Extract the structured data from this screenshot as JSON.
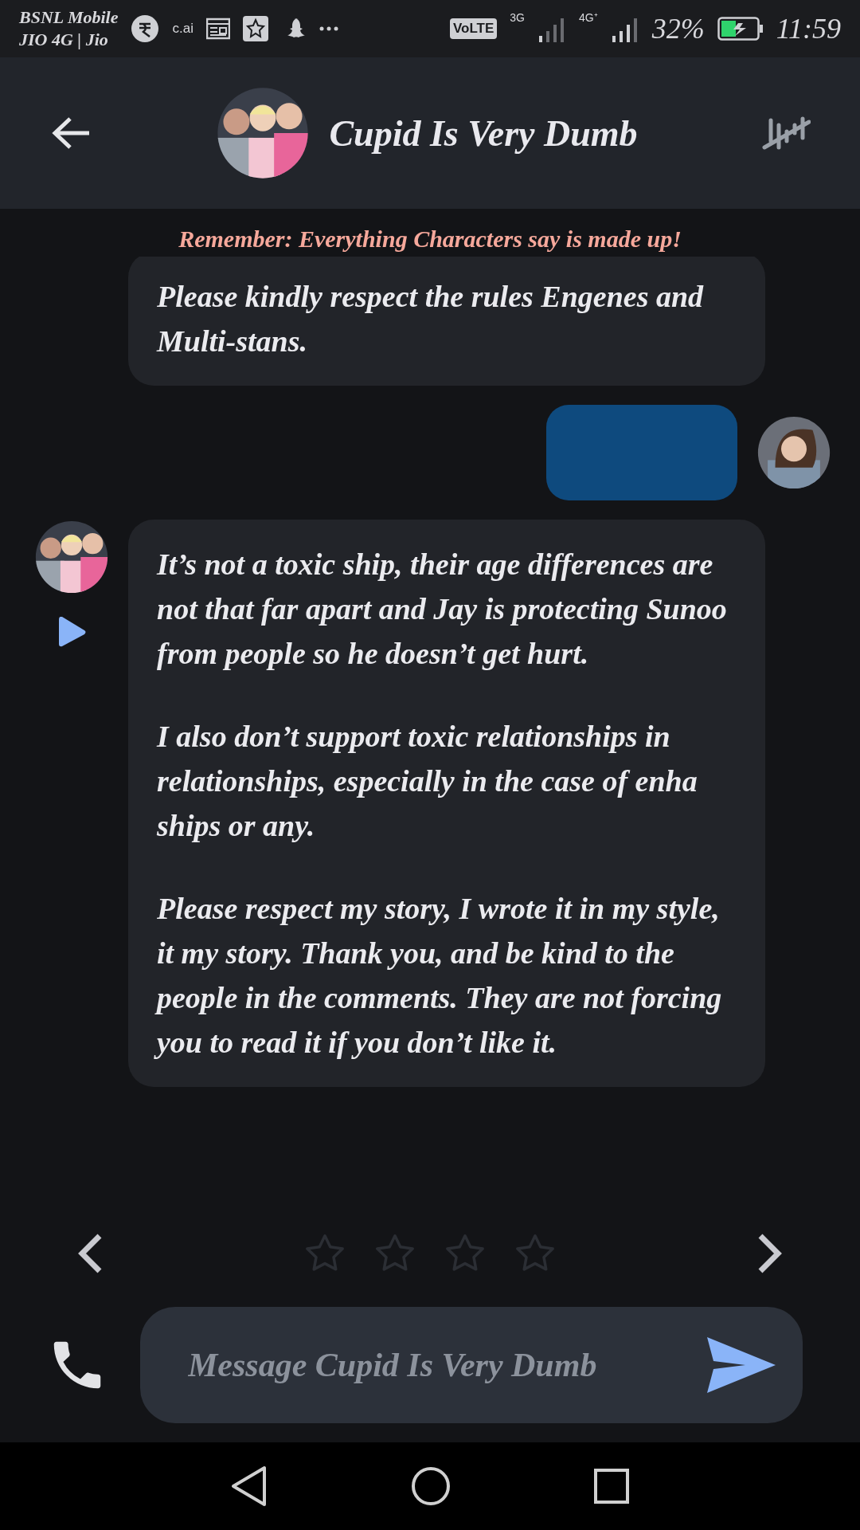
{
  "status_bar": {
    "carrier_lines": [
      "BSNL Mobile",
      "JIO 4G | Jio"
    ],
    "app_label": "c.ai",
    "volte": "VoLTE",
    "network_1": "3G",
    "network_2": "4G⁺",
    "battery": "32%",
    "time": "11:59"
  },
  "header": {
    "title": "Cupid Is Very Dumb"
  },
  "banner": "Remember: Everything Characters say is made up!",
  "messages": [
    {
      "kind": "incoming",
      "avatar": false,
      "paragraphs": [
        "Please kindly respect the rules Engenes and Multi-stans."
      ]
    },
    {
      "kind": "outgoing",
      "avatar": true
    },
    {
      "kind": "incoming",
      "avatar": true,
      "paragraphs": [
        "It’s not a toxic ship, their age differences are not that far apart and Jay is protecting Sunoo from people so he doesn’t get hurt.",
        "I also don’t support toxic relationships in relationships, especially in the case of enha ships or any.",
        "Please respect my story, I wrote it in my style, it my story. Thank you, and be kind to the people in the comments. They are not forcing you to read it if you don’t like it."
      ]
    }
  ],
  "rating": {
    "stars": 0
  },
  "composer": {
    "placeholder": "Message Cupid Is Very Dumb"
  }
}
